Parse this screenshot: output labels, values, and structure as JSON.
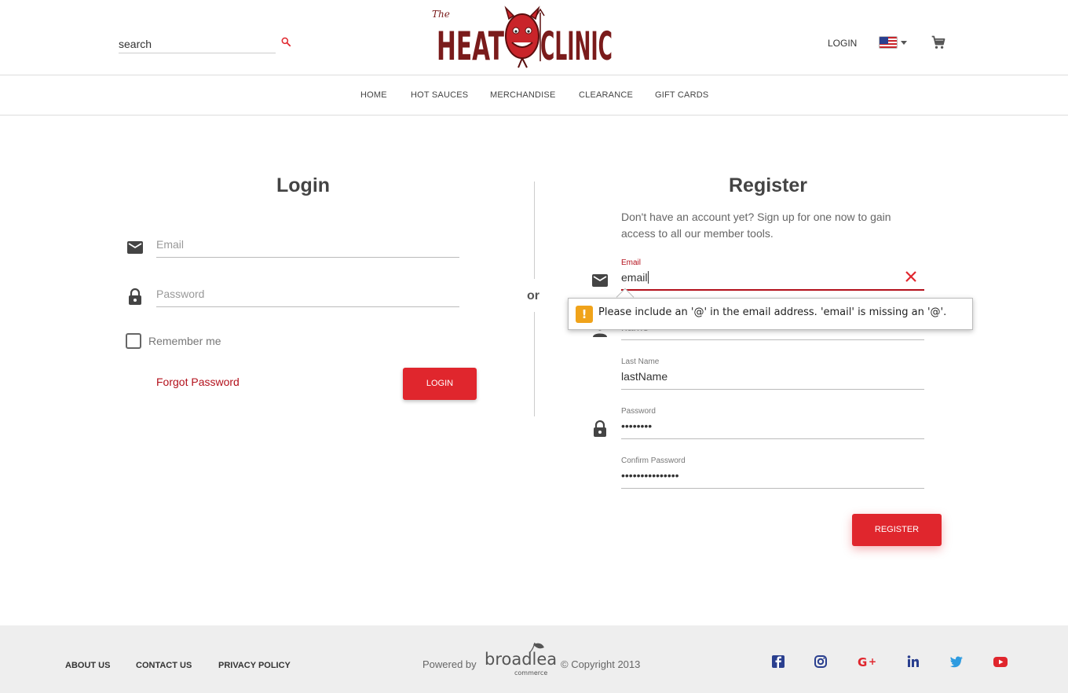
{
  "header": {
    "search_placeholder": "search",
    "logo_alt": "The HEAT CLINIC",
    "login_label": "LOGIN",
    "locale_flag": "us-flag-icon",
    "cart_icon": "cart-icon"
  },
  "nav": {
    "items": [
      "HOME",
      "HOT SAUCES",
      "MERCHANDISE",
      "CLEARANCE",
      "GIFT CARDS"
    ]
  },
  "login": {
    "title": "Login",
    "email_placeholder": "Email",
    "password_placeholder": "Password",
    "remember_label": "Remember me",
    "forgot_label": "Forgot Password",
    "button_label": "LOGIN"
  },
  "divider": {
    "or_label": "or"
  },
  "register": {
    "title": "Register",
    "description": "Don't have an account yet? Sign up for one now to gain access to all our member tools.",
    "email_label": "Email",
    "email_value": "email",
    "first_name_value": "name",
    "last_name_label": "Last Name",
    "last_name_value": "lastName",
    "password_label": "Password",
    "password_value": "••••••••",
    "confirm_label": "Confirm Password",
    "confirm_value": "•••••••••••••••",
    "button_label": "REGISTER"
  },
  "validation": {
    "message": "Please include an '@' in the email address. 'email' is missing an '@'."
  },
  "footer": {
    "links": [
      "ABOUT US",
      "CONTACT US",
      "PRIVACY POLICY"
    ],
    "powered_by": "Powered by",
    "broadleaf_name": "broadleaf",
    "broadleaf_sub": "commerce",
    "copyright": "© Copyright 2013",
    "social": [
      "facebook-icon",
      "instagram-icon",
      "google-plus-icon",
      "linkedin-icon",
      "twitter-icon",
      "youtube-icon"
    ]
  },
  "colors": {
    "accent": "#e0262d",
    "link": "#b3101b",
    "warning": "#f0a31a"
  }
}
